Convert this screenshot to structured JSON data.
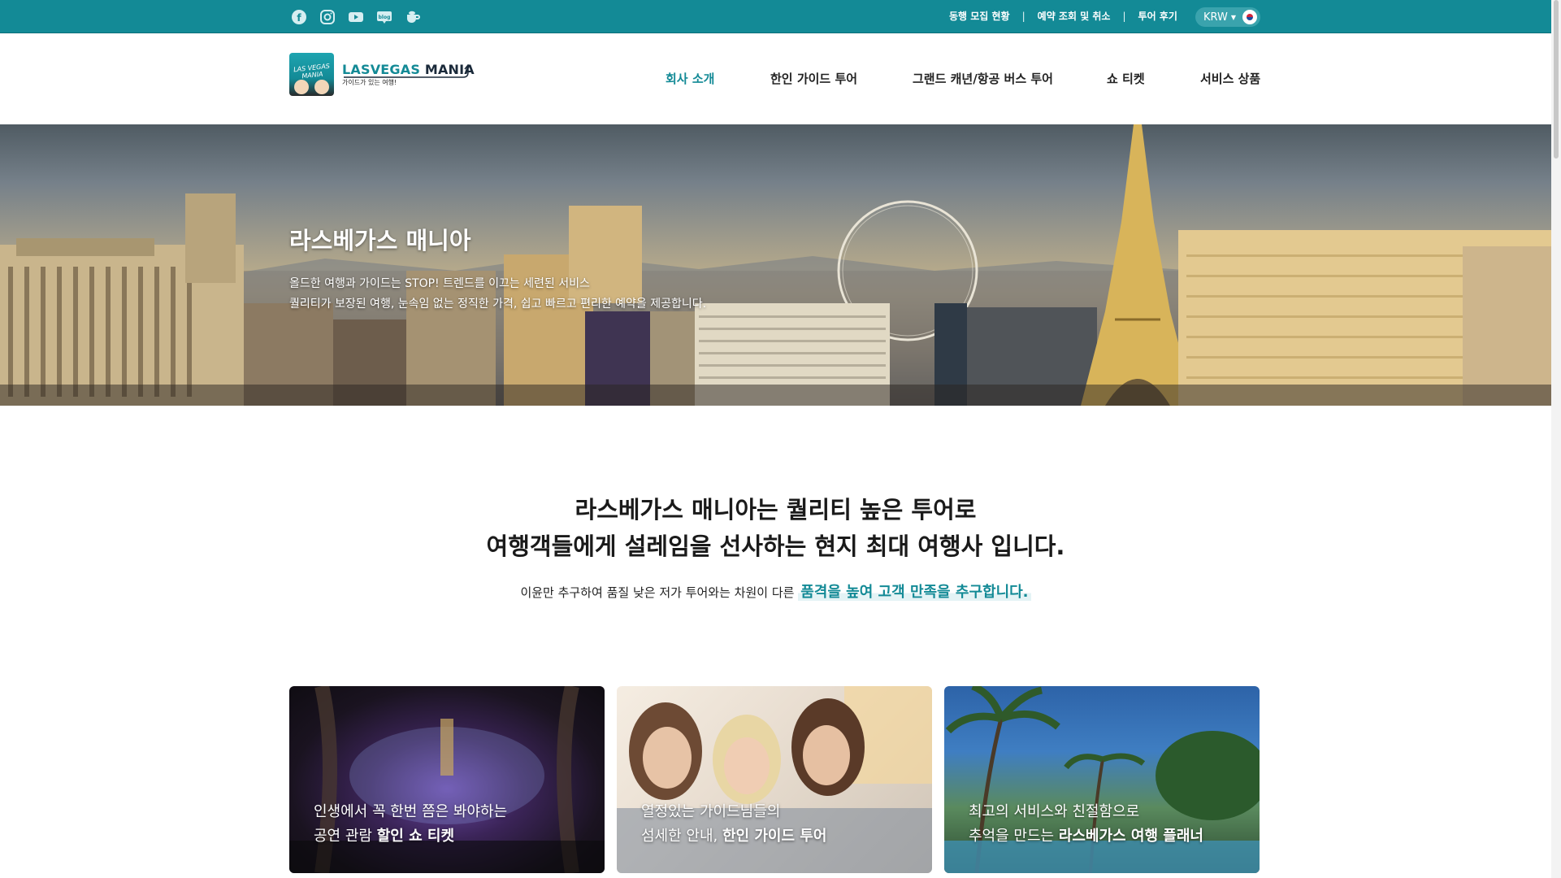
{
  "topbar": {
    "social": [
      {
        "icon": "facebook-icon",
        "glyph": "f"
      },
      {
        "icon": "instagram-icon",
        "glyph": "◎"
      },
      {
        "icon": "youtube-icon",
        "glyph": "▶"
      },
      {
        "icon": "blog-icon",
        "glyph": "blog"
      },
      {
        "icon": "cafe-icon",
        "glyph": "☕"
      }
    ],
    "links": [
      "동행 모집 현황",
      "예약 조회 및 취소",
      "투어 후기"
    ],
    "separator": "|",
    "currency": "KRW",
    "flag_icon": "korea-flag-icon"
  },
  "header": {
    "logo_text_a": "LASVEGAS",
    "logo_text_b": "MANIA",
    "logo_tagline": "가이드가 있는 여행!",
    "logo_badge": "LAS VEGAS MANIA",
    "nav": [
      "회사 소개",
      "한인 가이드 투어",
      "그랜드 캐년/항공 버스 투어",
      "쇼 티켓",
      "서비스 상품"
    ],
    "active_nav": 0
  },
  "hero": {
    "title": "라스베가스 매니아",
    "desc_line1": "올드한 여행과 가이드는 STOP! 트렌드를 이끄는 세련된 서비스",
    "desc_line2": "퀄리티가 보장된 여행, 눈속임 없는 정직한 가격, 쉽고 빠르고 편리한 예약을 제공합니다."
  },
  "intro": {
    "heading_line1": "라스베가스 매니아는 퀄리티 높은 투어로",
    "heading_line2": "여행객들에게 설레임을 선사하는 현지 최대 여행사 입니다.",
    "sub_text": "이윤만 추구하여 품질 낮은 저가 투어와는 차원이 다른",
    "sub_highlight": "품격을 높여 고객 만족을 추구합니다."
  },
  "cards": [
    {
      "line1": "인생에서 꼭 한번 쯤은 봐야하는",
      "line2_prefix": "공연 관람 ",
      "line2_bold": "할인 쇼 티켓"
    },
    {
      "line1": "열정있는 가이드님들의",
      "line2_prefix": "섬세한 안내, ",
      "line2_bold": "한인 가이드 투어"
    },
    {
      "line1": "최고의 서비스와 친절함으로",
      "line2_prefix": "추억을 만드는 ",
      "line2_bold": "라스베가스 여행 플래너"
    }
  ],
  "colors": {
    "brand": "#138a96",
    "highlight_bg": "#e4f3f5"
  }
}
